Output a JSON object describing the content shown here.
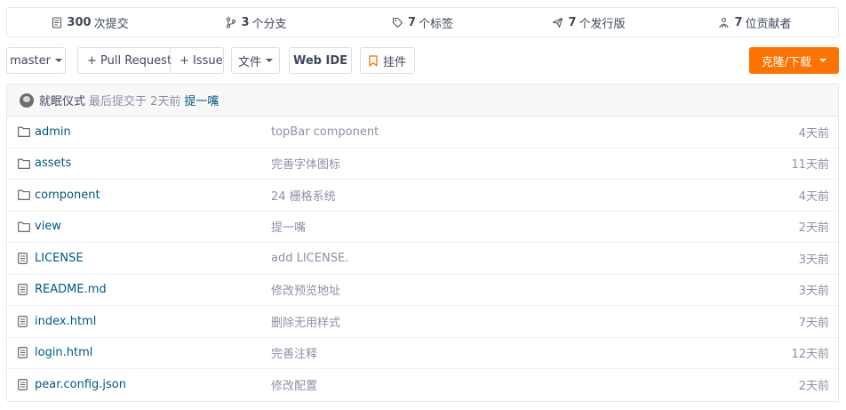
{
  "stats": [
    {
      "icon": "commit-icon",
      "count": "300",
      "label": "次提交"
    },
    {
      "icon": "branch-icon",
      "count": "3",
      "label": "个分支"
    },
    {
      "icon": "tag-icon",
      "count": "7",
      "label": "个标签"
    },
    {
      "icon": "release-icon",
      "count": "7",
      "label": "个发行版"
    },
    {
      "icon": "contributors-icon",
      "count": "7",
      "label": "位贡献者"
    }
  ],
  "toolbar": {
    "branch": "master",
    "pull_request": "+ Pull Request",
    "issue": "+ Issue",
    "files": "文件",
    "web_ide": "Web IDE",
    "widget": "挂件",
    "clone": "克隆/下载",
    "clone_color": "#fe7300",
    "widget_icon_color": "#fe7300"
  },
  "last_commit": {
    "author": "就眠仪式",
    "text": "最后提交于 2天前",
    "message": "提一嘴"
  },
  "files": [
    {
      "type": "folder",
      "icon": "folder-icon",
      "name": "admin",
      "message": "topBar component",
      "time": "4天前"
    },
    {
      "type": "folder",
      "icon": "folder-icon",
      "name": "assets",
      "message": "完善字体图标",
      "time": "11天前"
    },
    {
      "type": "folder",
      "icon": "folder-icon",
      "name": "component",
      "message": "24 栅格系统",
      "time": "4天前"
    },
    {
      "type": "folder",
      "icon": "folder-icon",
      "name": "view",
      "message": "提一嘴",
      "time": "2天前"
    },
    {
      "type": "file",
      "icon": "file-icon",
      "name": "LICENSE",
      "message": "add LICENSE.",
      "time": "3天前"
    },
    {
      "type": "file",
      "icon": "file-icon",
      "name": "README.md",
      "message": "修改预览地址",
      "time": "3天前"
    },
    {
      "type": "file",
      "icon": "file-icon",
      "name": "index.html",
      "message": "删除无用样式",
      "time": "7天前"
    },
    {
      "type": "file",
      "icon": "file-icon",
      "name": "login.html",
      "message": "完善注释",
      "time": "12天前"
    },
    {
      "type": "file",
      "icon": "file-icon",
      "name": "pear.config.json",
      "message": "修改配置",
      "time": "2天前"
    }
  ]
}
